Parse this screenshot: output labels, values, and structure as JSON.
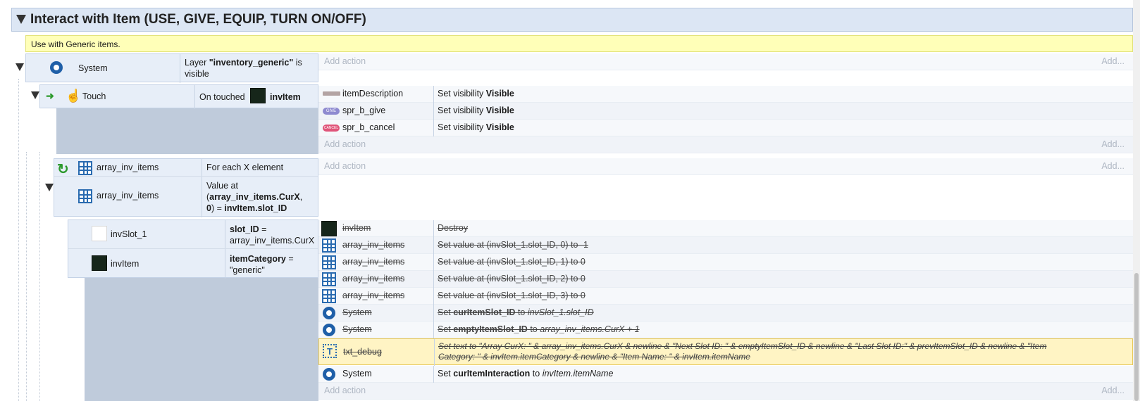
{
  "group": {
    "title": "Interact with Item (USE, GIVE, EQUIP, TURN ON/OFF)"
  },
  "comment": "Use with Generic items.",
  "add_action": "Add action",
  "add_short": "Add...",
  "event1": {
    "object": "System",
    "cond_prefix": "Layer ",
    "cond_bold": "\"inventory_generic\"",
    "cond_suffix": " is visible"
  },
  "event2": {
    "object": "Touch",
    "cond_prefix": "On touched ",
    "cond_bold": "invItem",
    "actions": [
      {
        "object": "itemDescription",
        "prefix": "Set visibility ",
        "bold": "Visible"
      },
      {
        "object": "spr_b_give",
        "prefix": "Set visibility ",
        "bold": "Visible"
      },
      {
        "object": "spr_b_cancel",
        "prefix": "Set visibility ",
        "bold": "Visible"
      }
    ]
  },
  "event3": {
    "object1": "array_inv_items",
    "cond1": "For each X element",
    "object2": "array_inv_items",
    "cond2_a": "Value at",
    "cond2_b1": "(",
    "cond2_b2": "array_inv_items.CurX",
    "cond2_b3": ",",
    "cond2_c1": "0",
    "cond2_c2": ") = ",
    "cond2_c3": "invItem.slot_ID"
  },
  "event4": {
    "object1": "invSlot_1",
    "cond1_bold": "slot_ID",
    "cond1_suffix": " =",
    "cond1_line2": "array_inv_items.CurX",
    "object2": "invItem",
    "cond2_bold": "itemCategory",
    "cond2_suffix": " =",
    "cond2_line2": "\"generic\"",
    "actions": [
      {
        "object": "invItem",
        "text": "Destroy"
      },
      {
        "object": "array_inv_items",
        "text": "Set value at (invSlot_1.slot_ID, 0) to -1"
      },
      {
        "object": "array_inv_items",
        "text": "Set value at (invSlot_1.slot_ID, 1) to 0"
      },
      {
        "object": "array_inv_items",
        "text": "Set value at (invSlot_1.slot_ID, 2) to 0"
      },
      {
        "object": "array_inv_items",
        "text": "Set value at (invSlot_1.slot_ID, 3) to 0"
      },
      {
        "object": "System",
        "prefix": "Set ",
        "bold": "curItemSlot_ID",
        "suffix": " to ",
        "ital": "invSlot_1.slot_ID"
      },
      {
        "object": "System",
        "prefix": "Set ",
        "bold": "emptyItemSlot_ID",
        "suffix": " to ",
        "ital": "array_inv_items.CurX + 1"
      },
      {
        "object": "txt_debug",
        "line1": "Set text to \"Array CurX: \" & array_inv_items.CurX & newline & \"Next Slot ID: \" & emptyItemSlot_ID & newline & \"Last Slot ID:\" & prevItemSlot_ID & newline & \"Item",
        "line2": "Category: \" & invItem.itemCategory & newline & \"Item Name: \" & invItem.itemName"
      },
      {
        "object": "System",
        "prefix": "Set ",
        "bold": "curItemInteraction",
        "suffix": " to ",
        "ital": "invItem.itemName"
      }
    ]
  },
  "icons": {
    "give_badge": "GIVE",
    "cancel_badge": "CANCEL"
  }
}
